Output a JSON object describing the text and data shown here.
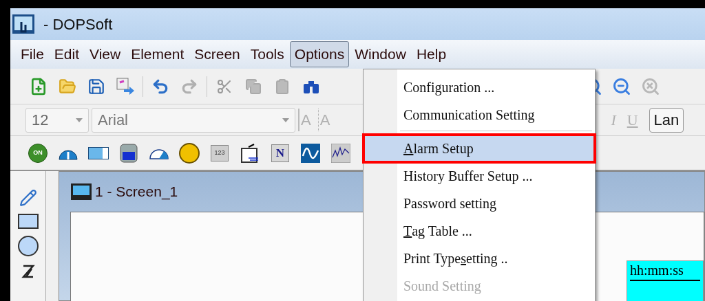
{
  "window": {
    "title": "- DOPSoft"
  },
  "menu_bar": [
    {
      "label": "File",
      "selected": false
    },
    {
      "label": "Edit",
      "selected": false
    },
    {
      "label": "View",
      "selected": false
    },
    {
      "label": "Element",
      "selected": false
    },
    {
      "label": "Screen",
      "selected": false
    },
    {
      "label": "Tools",
      "selected": false
    },
    {
      "label": "Options",
      "selected": true
    },
    {
      "label": "Window",
      "selected": false
    },
    {
      "label": "Help",
      "selected": false
    }
  ],
  "format_toolbar": {
    "font_size": "12",
    "font_name": "Arial",
    "buttons": [
      {
        "kind": "grow",
        "label": "A"
      },
      {
        "kind": "shrink",
        "label": "A"
      },
      {
        "kind": "italic",
        "label": "I"
      },
      {
        "kind": "underline",
        "label": "U"
      }
    ],
    "language_button": "Lan"
  },
  "element_toolbar": [
    {
      "kind": "on-button",
      "label": "ON"
    },
    {
      "kind": "gauge"
    },
    {
      "kind": "bar"
    },
    {
      "kind": "tank"
    },
    {
      "kind": "meter"
    },
    {
      "kind": "lamp"
    },
    {
      "kind": "numeric",
      "label": "123"
    },
    {
      "kind": "display"
    },
    {
      "kind": "text",
      "label": "N"
    },
    {
      "kind": "wave"
    },
    {
      "kind": "trend"
    }
  ],
  "screen_window": {
    "title": "1 - Screen_1",
    "clock_element": "hh:mm:ss"
  },
  "options_menu": [
    {
      "kind": "item",
      "after": "Configuration ...",
      "selected": false,
      "disabled": false
    },
    {
      "kind": "item",
      "after": "Communication Setting",
      "selected": false,
      "disabled": false
    },
    {
      "kind": "separator"
    },
    {
      "kind": "item",
      "key": "A",
      "after": "larm Setup",
      "selected": true,
      "disabled": false
    },
    {
      "kind": "item",
      "after": "History Buffer Setup ...",
      "selected": false,
      "disabled": false
    },
    {
      "kind": "item",
      "after": "Password setting",
      "selected": false,
      "disabled": false
    },
    {
      "kind": "item",
      "key": "T",
      "after": "ag Table ...",
      "selected": false,
      "disabled": false
    },
    {
      "kind": "item",
      "before": "Print Type",
      "key": "s",
      "after": "etting ..",
      "selected": false,
      "disabled": false
    },
    {
      "kind": "item",
      "after": "Sound Setting",
      "selected": false,
      "disabled": true
    }
  ]
}
